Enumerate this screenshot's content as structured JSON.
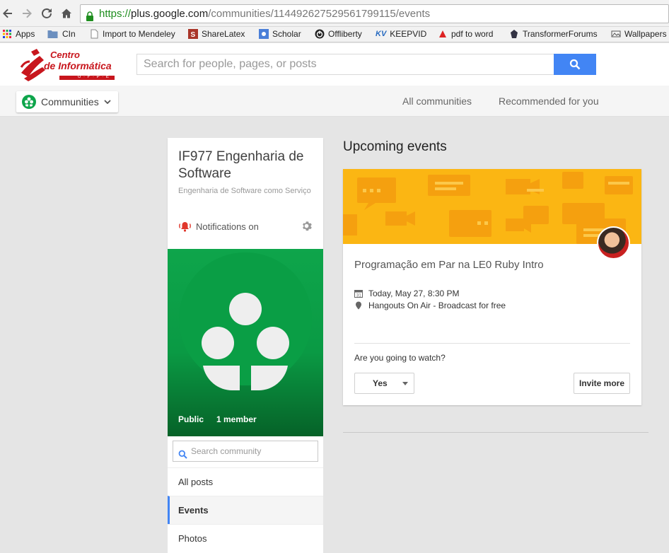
{
  "browser": {
    "url_scheme": "https://",
    "url_host": "plus.google.com",
    "url_path": "/communities/114492627529561799115/events",
    "bookmarks": [
      {
        "label": "Apps",
        "icon": "apps-grid-icon"
      },
      {
        "label": "CIn",
        "icon": "folder-icon"
      },
      {
        "label": "Import to Mendeley",
        "icon": "page-icon"
      },
      {
        "label": "ShareLatex",
        "icon": "sharelatex-icon"
      },
      {
        "label": "Scholar",
        "icon": "scholar-icon"
      },
      {
        "label": "Offliberty",
        "icon": "power-icon"
      },
      {
        "label": "KEEPVID",
        "icon": "keepvid-icon"
      },
      {
        "label": "pdf to word",
        "icon": "pdf-icon"
      },
      {
        "label": "TransformerForums",
        "icon": "transformer-icon"
      },
      {
        "label": "Wallpapers",
        "icon": "wallpapers-icon"
      }
    ]
  },
  "header": {
    "logo_line1": "Centro",
    "logo_line2": "de Informática",
    "logo_line3": "U · F · P · E",
    "search_placeholder": "Search for people, pages, or posts"
  },
  "subbar": {
    "dropdown_label": "Communities",
    "links": [
      "All communities",
      "Recommended for you"
    ]
  },
  "community": {
    "title": "IF977 Engenharia de Software",
    "subtitle": "Engenharia de Software como Serviço",
    "notifications": "Notifications on",
    "visibility": "Public",
    "members": "1 member",
    "search_placeholder": "Search community",
    "nav": [
      "All posts",
      "Events",
      "Photos"
    ]
  },
  "events": {
    "heading": "Upcoming events",
    "title": "Programação em Par na LE0 Ruby Intro",
    "when": "Today, May 27, 8:30 PM",
    "where": "Hangouts On Air - Broadcast for free",
    "question": "Are you going to watch?",
    "rsvp": "Yes",
    "invite": "Invite more",
    "colors": {
      "banner": "#fbb613",
      "accent": "#4285f4",
      "community_green": "#0ea54b"
    }
  }
}
